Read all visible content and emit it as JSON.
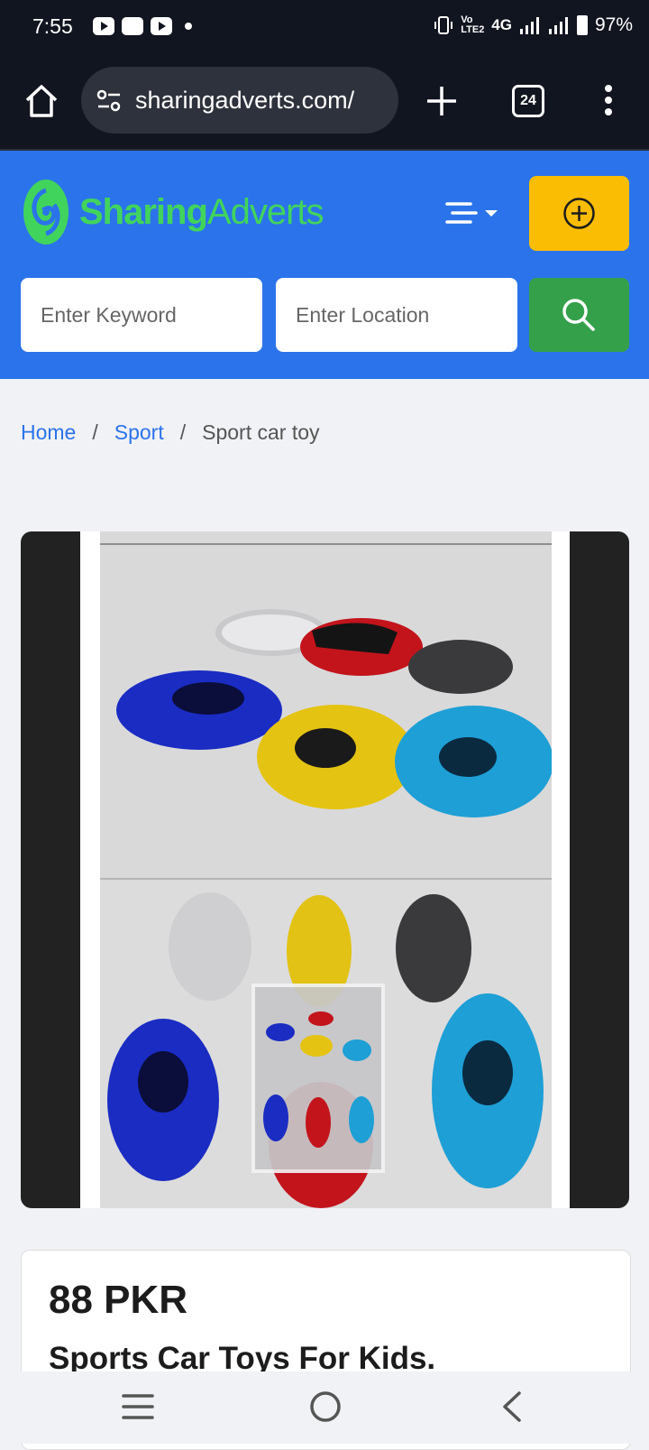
{
  "status_bar": {
    "time": "7:55",
    "network": "4G",
    "volte_label": "Vo LTE2",
    "battery": "97%"
  },
  "browser": {
    "url": "sharingadverts.com/",
    "tab_count": "24",
    "icons": [
      "home-icon",
      "site-settings-icon",
      "new-tab-plus-icon",
      "tab-switcher-icon",
      "more-vert-icon"
    ]
  },
  "header": {
    "logo_primary": "Sharing",
    "logo_secondary": "Adverts",
    "keyword_placeholder": "Enter Keyword",
    "location_placeholder": "Enter Location",
    "colors": {
      "header_bg": "#2b73ea",
      "logo_green": "#41d45d",
      "post_button": "#fbbc04",
      "search_button": "#34a14a"
    }
  },
  "breadcrumb": {
    "home": "Home",
    "separator": "/",
    "category": "Sport",
    "current": "Sport car toy"
  },
  "listing": {
    "price": "88 PKR",
    "title": "Sports Car Toys For Kids."
  },
  "system_nav": {
    "icons": [
      "recents-icon",
      "home-circle-icon",
      "back-icon"
    ]
  }
}
